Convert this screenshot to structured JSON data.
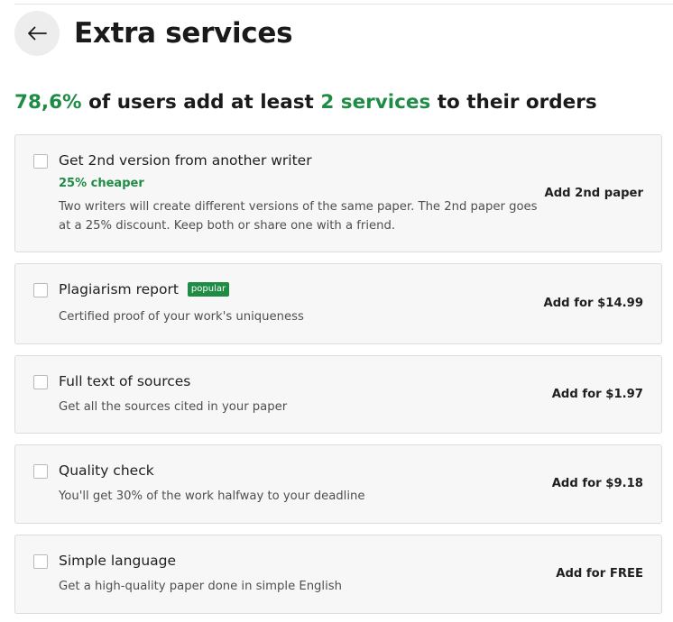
{
  "header": {
    "back_icon": "arrow-left-icon",
    "title": "Extra services"
  },
  "headline": {
    "percent": "78,6%",
    "text_before": " of users add at least ",
    "services": "2 services",
    "text_after": " to their orders"
  },
  "colors": {
    "accent_green": "#1e8c45",
    "card_background": "#f7f7f7",
    "card_border": "#dcdcdc"
  },
  "services": [
    {
      "title": "Get 2nd version from another writer",
      "subtitle": "25% cheaper",
      "description": "Two writers will create different versions of the same paper. The 2nd paper goes at a 25% discount. Keep both or share one with a friend.",
      "action": "Add 2nd paper",
      "checked": false
    },
    {
      "title": "Plagiarism report",
      "badge": "popular",
      "description": "Certified proof of your work's uniqueness",
      "action": "Add for $14.99",
      "checked": false
    },
    {
      "title": "Full text of sources",
      "description": "Get all the sources cited in your paper",
      "action": "Add for $1.97",
      "checked": false
    },
    {
      "title": "Quality check",
      "description": "You'll get 30% of the work halfway to your deadline",
      "action": "Add for $9.18",
      "checked": false
    },
    {
      "title": "Simple language",
      "description": "Get a high-quality paper done in simple English",
      "action": "Add for FREE",
      "checked": false
    }
  ]
}
